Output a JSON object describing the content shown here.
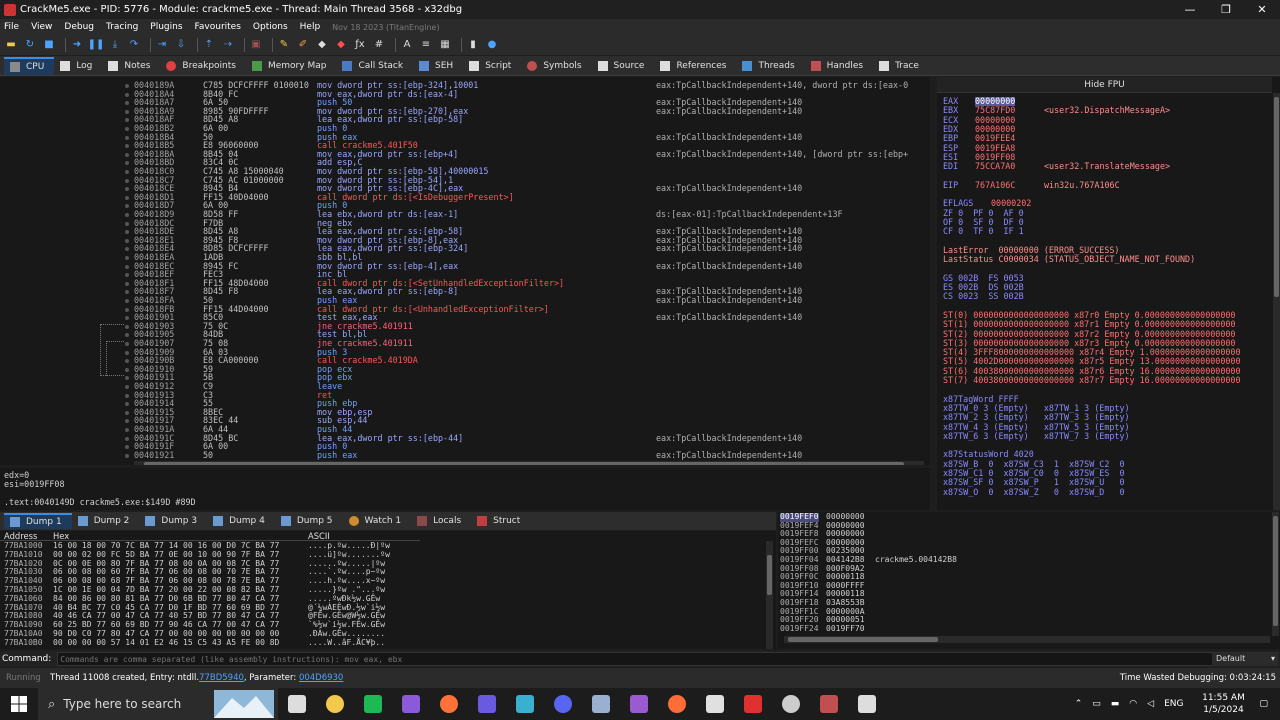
{
  "window": {
    "title": "CrackMe5.exe - PID: 5776 - Module: crackme5.exe - Thread: Main Thread 3568 - x32dbg",
    "minimize": "—",
    "maximize": "❐",
    "close": "✕"
  },
  "menu": {
    "items": [
      "File",
      "View",
      "Debug",
      "Tracing",
      "Plugins",
      "Favourites",
      "Options",
      "Help"
    ],
    "date": "Nov 18 2023 (TitanEngine)"
  },
  "tabs": [
    {
      "label": "CPU",
      "icon_color": "#8a8a8a"
    },
    {
      "label": "Log",
      "icon_color": "#dddddd"
    },
    {
      "label": "Notes",
      "icon_color": "#dddddd"
    },
    {
      "label": "Breakpoints",
      "icon_color": "#e04040"
    },
    {
      "label": "Memory Map",
      "icon_color": "#4a9a4a"
    },
    {
      "label": "Call Stack",
      "icon_color": "#4a7ac0"
    },
    {
      "label": "SEH",
      "icon_color": "#5a8ad0"
    },
    {
      "label": "Script",
      "icon_color": "#dddddd"
    },
    {
      "label": "Symbols",
      "icon_color": "#c05050"
    },
    {
      "label": "Source",
      "icon_color": "#dddddd"
    },
    {
      "label": "References",
      "icon_color": "#dddddd"
    },
    {
      "label": "Threads",
      "icon_color": "#4a90d0"
    },
    {
      "label": "Handles",
      "icon_color": "#c05050"
    },
    {
      "label": "Trace",
      "icon_color": "#dddddd"
    }
  ],
  "disasm": [
    {
      "a": "0040189A",
      "b": "C785 DCFCFFFF 0100010",
      "i": "mov dword ptr ss:[ebp-324],10001",
      "c": "eax:TpCallbackIndependent+140, dword ptr ds:[eax-0",
      "t": "mov"
    },
    {
      "a": "004018A4",
      "b": "8B40 FC",
      "i": "mov eax,dword ptr ds:[eax-4]",
      "c": "",
      "t": "mov"
    },
    {
      "a": "004018A7",
      "b": "6A 50",
      "i": "push 50",
      "c": "eax:TpCallbackIndependent+140",
      "t": "push"
    },
    {
      "a": "004018A9",
      "b": "8985 90FDFFFF",
      "i": "mov dword ptr ss:[ebp-270],eax",
      "c": "eax:TpCallbackIndependent+140",
      "t": "mov"
    },
    {
      "a": "004018AF",
      "b": "8D45 A8",
      "i": "lea eax,dword ptr ss:[ebp-58]",
      "c": "",
      "t": "mov"
    },
    {
      "a": "004018B2",
      "b": "6A 00",
      "i": "push 0",
      "c": "",
      "t": "push"
    },
    {
      "a": "004018B4",
      "b": "50",
      "i": "push eax",
      "c": "eax:TpCallbackIndependent+140",
      "t": "push"
    },
    {
      "a": "004018B5",
      "b": "E8 96060000",
      "i": "call crackme5.401F50",
      "c": "",
      "t": "call"
    },
    {
      "a": "004018BA",
      "b": "8B45 04",
      "i": "mov eax,dword ptr ss:[ebp+4]",
      "c": "eax:TpCallbackIndependent+140, [dword ptr ss:[ebp+",
      "t": "mov"
    },
    {
      "a": "004018BD",
      "b": "83C4 0C",
      "i": "add esp,C",
      "c": "",
      "t": "mov"
    },
    {
      "a": "004018C0",
      "b": "C745 A8 15000040",
      "i": "mov dword ptr ss:[ebp-58],40000015",
      "c": "",
      "t": "mov"
    },
    {
      "a": "004018C7",
      "b": "C745 AC 01000000",
      "i": "mov dword ptr ss:[ebp-54],1",
      "c": "",
      "t": "mov"
    },
    {
      "a": "004018CE",
      "b": "8945 B4",
      "i": "mov dword ptr ss:[ebp-4C],eax",
      "c": "eax:TpCallbackIndependent+140",
      "t": "mov"
    },
    {
      "a": "004018D1",
      "b": "FF15 40D04000",
      "i": "call dword ptr ds:[<IsDebuggerPresent>]",
      "c": "",
      "t": "call"
    },
    {
      "a": "004018D7",
      "b": "6A 00",
      "i": "push 0",
      "c": "",
      "t": "push"
    },
    {
      "a": "004018D9",
      "b": "8D58 FF",
      "i": "lea ebx,dword ptr ds:[eax-1]",
      "c": "ds:[eax-01]:TpCallbackIndependent+13F",
      "t": "mov"
    },
    {
      "a": "004018DC",
      "b": "F7DB",
      "i": "neg ebx",
      "c": "",
      "t": "mov"
    },
    {
      "a": "004018DE",
      "b": "8D45 A8",
      "i": "lea eax,dword ptr ss:[ebp-58]",
      "c": "eax:TpCallbackIndependent+140",
      "t": "mov"
    },
    {
      "a": "004018E1",
      "b": "8945 F8",
      "i": "mov dword ptr ss:[ebp-8],eax",
      "c": "eax:TpCallbackIndependent+140",
      "t": "mov"
    },
    {
      "a": "004018E4",
      "b": "8D85 DCFCFFFF",
      "i": "lea eax,dword ptr ss:[ebp-324]",
      "c": "eax:TpCallbackIndependent+140",
      "t": "mov"
    },
    {
      "a": "004018EA",
      "b": "1ADB",
      "i": "sbb bl,bl",
      "c": "",
      "t": "mov"
    },
    {
      "a": "004018EC",
      "b": "8945 FC",
      "i": "mov dword ptr ss:[ebp-4],eax",
      "c": "eax:TpCallbackIndependent+140",
      "t": "mov"
    },
    {
      "a": "004018EF",
      "b": "FEC3",
      "i": "inc bl",
      "c": "",
      "t": "mov"
    },
    {
      "a": "004018F1",
      "b": "FF15 48D04000",
      "i": "call dword ptr ds:[<SetUnhandledExceptionFilter>]",
      "c": "",
      "t": "call"
    },
    {
      "a": "004018F7",
      "b": "8D45 F8",
      "i": "lea eax,dword ptr ss:[ebp-8]",
      "c": "eax:TpCallbackIndependent+140",
      "t": "mov"
    },
    {
      "a": "004018FA",
      "b": "50",
      "i": "push eax",
      "c": "eax:TpCallbackIndependent+140",
      "t": "push"
    },
    {
      "a": "004018FB",
      "b": "FF15 44D04000",
      "i": "call dword ptr ds:[<UnhandledExceptionFilter>]",
      "c": "",
      "t": "call"
    },
    {
      "a": "00401901",
      "b": "85C0",
      "i": "test eax,eax",
      "c": "eax:TpCallbackIndependent+140",
      "t": "mov"
    },
    {
      "a": "00401903",
      "b": "75 0C",
      "i": "jne crackme5.401911",
      "c": "",
      "t": "jmp"
    },
    {
      "a": "00401905",
      "b": "84DB",
      "i": "test bl,bl",
      "c": "",
      "t": "mov"
    },
    {
      "a": "00401907",
      "b": "75 08",
      "i": "jne crackme5.401911",
      "c": "",
      "t": "jmp"
    },
    {
      "a": "00401909",
      "b": "6A 03",
      "i": "push 3",
      "c": "",
      "t": "push"
    },
    {
      "a": "0040190B",
      "b": "E8 CA000000",
      "i": "call crackme5.4019DA",
      "c": "",
      "t": "call"
    },
    {
      "a": "00401910",
      "b": "59",
      "i": "pop ecx",
      "c": "",
      "t": "push"
    },
    {
      "a": "00401911",
      "b": "5B",
      "i": "pop ebx",
      "c": "",
      "t": "push"
    },
    {
      "a": "00401912",
      "b": "C9",
      "i": "leave",
      "c": "",
      "t": "push"
    },
    {
      "a": "00401913",
      "b": "C3",
      "i": "ret",
      "c": "",
      "t": "ret"
    },
    {
      "a": "00401914",
      "b": "55",
      "i": "push ebp",
      "c": "",
      "t": "push"
    },
    {
      "a": "00401915",
      "b": "8BEC",
      "i": "mov ebp,esp",
      "c": "",
      "t": "mov"
    },
    {
      "a": "00401917",
      "b": "83EC 44",
      "i": "sub esp,44",
      "c": "",
      "t": "mov"
    },
    {
      "a": "0040191A",
      "b": "6A 44",
      "i": "push 44",
      "c": "",
      "t": "push"
    },
    {
      "a": "0040191C",
      "b": "8D45 BC",
      "i": "lea eax,dword ptr ss:[ebp-44]",
      "c": "eax:TpCallbackIndependent+140",
      "t": "mov"
    },
    {
      "a": "0040191F",
      "b": "6A 00",
      "i": "push 0",
      "c": "",
      "t": "push"
    },
    {
      "a": "00401921",
      "b": "50",
      "i": "push eax",
      "c": "eax:TpCallbackIndependent+140",
      "t": "push"
    }
  ],
  "info": {
    "line1": "edx=0",
    "line2": "esi=0019FF08",
    "line3": ".text:0040149D crackme5.exe:$149D #89D"
  },
  "regs": {
    "hide_fpu": "Hide FPU",
    "general": [
      {
        "n": "EAX",
        "v": "00000000",
        "c": "",
        "sel": true
      },
      {
        "n": "EBX",
        "v": "75C87FD0",
        "c": "<user32.DispatchMessageA>"
      },
      {
        "n": "ECX",
        "v": "00000000",
        "c": ""
      },
      {
        "n": "EDX",
        "v": "00000000",
        "c": ""
      },
      {
        "n": "EBP",
        "v": "0019FEE4",
        "c": ""
      },
      {
        "n": "ESP",
        "v": "0019FEA8",
        "c": ""
      },
      {
        "n": "ESI",
        "v": "0019FF08",
        "c": ""
      },
      {
        "n": "EDI",
        "v": "75CCA7A0",
        "c": "<user32.TranslateMessage>"
      }
    ],
    "eip": {
      "n": "EIP",
      "v": "767A106C",
      "c": "win32u.767A106C"
    },
    "eflags": {
      "n": "EFLAGS",
      "v": "00000202"
    },
    "flags": [
      "ZF 0  PF 0  AF 0",
      "OF 0  SF 0  DF 0",
      "CF 0  TF 0  IF 1"
    ],
    "lasterror": "LastError  00000000 (ERROR_SUCCESS)",
    "laststatus": "LastStatus C0000034 (STATUS_OBJECT_NAME_NOT_FOUND)",
    "segs": [
      "GS 002B  FS 0053",
      "ES 002B  DS 002B",
      "CS 0023  SS 002B"
    ],
    "st": [
      "ST(0) 0000000000000000000 x87r0 Empty 0.000000000000000000",
      "ST(1) 0000000000000000000 x87r1 Empty 0.000000000000000000",
      "ST(2) 0000000000000000000 x87r2 Empty 0.000000000000000000",
      "ST(3) 0000000000000000000 x87r3 Empty 0.000000000000000000",
      "ST(4) 3FFF8000000000000000 x87r4 Empty 1.000000000000000000",
      "ST(5) 4002D000000000000000 x87r5 Empty 13.00000000000000000",
      "ST(6) 40038000000000000000 x87r6 Empty 16.00000000000000000",
      "ST(7) 40038000000000000000 x87r7 Empty 16.00000000000000000"
    ],
    "tagword": "x87TagWord FFFF",
    "tags": [
      "x87TW_0 3 (Empty)   x87TW_1 3 (Empty)",
      "x87TW_2 3 (Empty)   x87TW_3 3 (Empty)",
      "x87TW_4 3 (Empty)   x87TW_5 3 (Empty)",
      "x87TW_6 3 (Empty)   x87TW_7 3 (Empty)"
    ],
    "statusword": "x87StatusWord 4020",
    "sw": [
      "x87SW_B  0  x87SW_C3  1  x87SW_C2  0",
      "x87SW_C1 0  x87SW_C0  0  x87SW_ES  0",
      "x87SW_SF 0  x87SW_P   1  x87SW_U   0",
      "x87SW_O  0  x87SW_Z   0  x87SW_D   0"
    ]
  },
  "dumptabs": [
    {
      "label": "Dump 1",
      "icon_color": "#6a9ad0"
    },
    {
      "label": "Dump 2",
      "icon_color": "#6a9ad0"
    },
    {
      "label": "Dump 3",
      "icon_color": "#6a9ad0"
    },
    {
      "label": "Dump 4",
      "icon_color": "#6a9ad0"
    },
    {
      "label": "Dump 5",
      "icon_color": "#6a9ad0"
    },
    {
      "label": "Watch 1",
      "icon_color": "#d08a30"
    },
    {
      "label": "Locals",
      "icon_color": "#8a4a4a"
    },
    {
      "label": "Struct",
      "icon_color": "#c04040"
    }
  ],
  "dump": {
    "headers": [
      "Address",
      "Hex",
      "ASCII"
    ],
    "rows": [
      {
        "a": "77BA1000",
        "h": "16 00 18 00 70 7C BA 77 14 00 16 00 D0 7C BA 77",
        "s": "....p.ºw.....Ð|ºw"
      },
      {
        "a": "77BA1010",
        "h": "00 00 02 00 FC 5D BA 77 0E 00 10 00 90 7F BA 77",
        "s": "....ü]ºw.......ºw"
      },
      {
        "a": "77BA1020",
        "h": "0C 00 0E 00 80 7F BA 77 08 00 0A 00 08 7C BA 77",
        "s": "......ºw.....|ºw"
      },
      {
        "a": "77BA1030",
        "h": "06 00 08 00 60 7F BA 77 06 00 08 00 70 7E BA 77",
        "s": "....`.ºw....p~ºw"
      },
      {
        "a": "77BA1040",
        "h": "06 00 08 00 68 7F BA 77 06 00 08 00 78 7E BA 77",
        "s": "....h.ºw....x~ºw"
      },
      {
        "a": "77BA1050",
        "h": "1C 00 1E 00 04 7D BA 77 20 00 22 00 08 82 BA 77",
        "s": ".....}ºw .\"...ºw"
      },
      {
        "a": "77BA1060",
        "h": "84 00 86 00 80 81 BA 77 D0 6B BD 77 80 47 CA 77",
        "s": ".....ºwÐk½w.GÊw"
      },
      {
        "a": "77BA1070",
        "h": "40 B4 BC 77 C0 45 CA 77 D0 1F BD 77 60 69 BD 77",
        "s": "@´¼wÀEÊwÐ.½w`i½w"
      },
      {
        "a": "77BA1080",
        "h": "40 46 CA 77 00 47 CA 77 40 57 BD 77 80 47 CA 77",
        "s": "@FÊw.GÊw@W½w.GÊw"
      },
      {
        "a": "77BA1090",
        "h": "60 25 BD 77 60 69 BD 77 90 46 CA 77 00 47 CA 77",
        "s": "`%½w`i½w.FÊw.GÊw"
      },
      {
        "a": "77BA10A0",
        "h": "90 D0 C0 77 80 47 CA 77 00 00 00 00 00 00 00 00",
        "s": ".ÐÀw.GÊw........"
      },
      {
        "a": "77BA10B0",
        "h": "00 00 00 00 57 14 01 E2 46 15 C5 43 A5 FE 00 8D",
        "s": "....W..âF.ÅC¥þ.."
      }
    ]
  },
  "stack": [
    {
      "a": "0019FEF0",
      "v": "00000000",
      "c": ""
    },
    {
      "a": "0019FEF4",
      "v": "00000000",
      "c": ""
    },
    {
      "a": "0019FEF8",
      "v": "00000000",
      "c": ""
    },
    {
      "a": "0019FEFC",
      "v": "00000000",
      "c": ""
    },
    {
      "a": "0019FF00",
      "v": "00235000",
      "c": ""
    },
    {
      "a": "0019FF04",
      "v": "004142B8",
      "c": "crackme5.004142B8"
    },
    {
      "a": "0019FF08",
      "v": "000F09A2",
      "c": ""
    },
    {
      "a": "0019FF0C",
      "v": "00000118",
      "c": ""
    },
    {
      "a": "0019FF10",
      "v": "0000FFFF",
      "c": ""
    },
    {
      "a": "0019FF14",
      "v": "00000118",
      "c": ""
    },
    {
      "a": "0019FF18",
      "v": "03A8553B",
      "c": ""
    },
    {
      "a": "0019FF1C",
      "v": "0000000A",
      "c": ""
    },
    {
      "a": "0019FF20",
      "v": "00000051",
      "c": ""
    },
    {
      "a": "0019FF24",
      "v": "0019FF70",
      "c": ""
    }
  ],
  "cmd": {
    "label": "Command:",
    "placeholder": "Commands are comma separated (like assembly instructions): mov eax, ebx",
    "select": "Default"
  },
  "status": {
    "state": "Running",
    "msg": "Thread 11008 created, Entry: ntdll.",
    "entry_link": "77BD5940",
    "param_label": ", Parameter: ",
    "param_link": "004D6930",
    "wasted": "Time Wasted Debugging: 0:03:24:15"
  },
  "taskbar": {
    "search": "Type here to search",
    "time": "11:55 AM",
    "date": "1/5/2024",
    "lang": "ENG",
    "apps": [
      {
        "name": "task-view",
        "color": "#dddddd"
      },
      {
        "name": "file-explorer",
        "color": "#f2c94c"
      },
      {
        "name": "spotify",
        "color": "#1db954"
      },
      {
        "name": "visual-studio",
        "color": "#8a5ad8"
      },
      {
        "name": "firefox",
        "color": "#ff7139"
      },
      {
        "name": "power-automate",
        "color": "#6a5ae0"
      },
      {
        "name": "cursor-app",
        "color": "#3ab0d0"
      },
      {
        "name": "discord",
        "color": "#5865f2"
      },
      {
        "name": "3d-box",
        "color": "#9ab0d0"
      },
      {
        "name": "purple-folder",
        "color": "#9a5ad0"
      },
      {
        "name": "postman",
        "color": "#ff6c37"
      },
      {
        "name": "linux",
        "color": "#e0e0e0"
      },
      {
        "name": "red-tool",
        "color": "#e03030"
      },
      {
        "name": "browser-circle",
        "color": "#cccccc"
      },
      {
        "name": "x32dbg",
        "color": "#c05050"
      },
      {
        "name": "calculator",
        "color": "#dddddd"
      }
    ]
  },
  "colors": {
    "accent": "#3a8ee6",
    "register_value": "#ff6f6f",
    "register_name": "#8a8aff",
    "instruction": "#9aa7ff",
    "call": "#ff5555"
  }
}
